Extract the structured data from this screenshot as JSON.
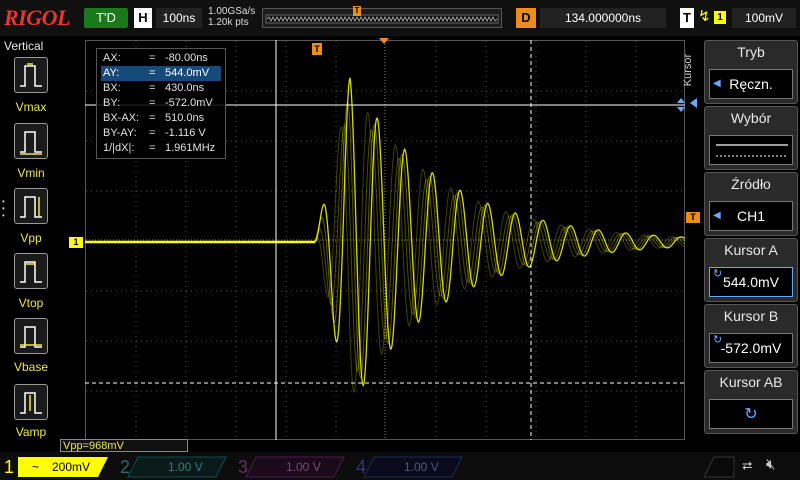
{
  "top": {
    "logo": "RIGOL",
    "trigger_status": "T'D",
    "horizontal_label": "H",
    "horizontal_scale": "100ns",
    "sample_rate": "1.00GSa/s",
    "memory_depth": "1.20k pts",
    "memory_trigger_marker": "T",
    "delay_label": "D",
    "delay_value": "134.000000ns",
    "trigger_label": "T",
    "trigger_edge_icon": "rising-edge-icon",
    "trigger_source": "1",
    "trigger_level": "100mV"
  },
  "left_panel": {
    "title": "Vertical",
    "items": [
      {
        "label": "Vmax",
        "icon": "vmax-icon"
      },
      {
        "label": "Vmin",
        "icon": "vmin-icon"
      },
      {
        "label": "Vpp",
        "icon": "vpp-icon"
      },
      {
        "label": "Vtop",
        "icon": "vtop-icon"
      },
      {
        "label": "Vbase",
        "icon": "vbase-icon"
      },
      {
        "label": "Vamp",
        "icon": "vamp-icon"
      }
    ]
  },
  "cursor_table": {
    "rows": [
      {
        "key": "AX:",
        "value": "-80.00ns"
      },
      {
        "key": "AY:",
        "value": "544.0mV"
      },
      {
        "key": "BX:",
        "value": "430.0ns"
      },
      {
        "key": "BY:",
        "value": "-572.0mV"
      },
      {
        "key": "BX-AX:",
        "value": "510.0ns"
      },
      {
        "key": "BY-AY:",
        "value": "-1.116 V"
      },
      {
        "key": "1/|dX|:",
        "value": "1.961MHz"
      }
    ],
    "eq": "="
  },
  "markers": {
    "trigger_position": "T",
    "channel1": "1",
    "trigger_level": "T"
  },
  "measurement": {
    "vpp": "Vpp=968mV"
  },
  "right_menu": {
    "side_tab": "Kursor",
    "items": [
      {
        "title": "Tryb",
        "value": "Ręczn."
      },
      {
        "title": "Wybór",
        "value": ""
      },
      {
        "title": "Źródło",
        "value": "CH1"
      },
      {
        "title": "Kursor A",
        "value": "544.0mV"
      },
      {
        "title": "Kursor B",
        "value": "-572.0mV"
      },
      {
        "title": "Kursor AB",
        "value": ""
      }
    ]
  },
  "channels": [
    {
      "num": "1",
      "coupling": "~",
      "scale": "200mV",
      "color": "#ffff00",
      "active": true
    },
    {
      "num": "2",
      "scale": "1.00 V",
      "color": "#00c8c8",
      "active": false
    },
    {
      "num": "3",
      "scale": "1.00 V",
      "color": "#d040d0",
      "active": false
    },
    {
      "num": "4",
      "scale": "1.00 V",
      "color": "#3c64ff",
      "active": false
    }
  ],
  "colors": {
    "ch1": "#ffff00",
    "trigger": "#f08c1e",
    "accent": "#6aa8ff",
    "logo": "#e8352f"
  }
}
